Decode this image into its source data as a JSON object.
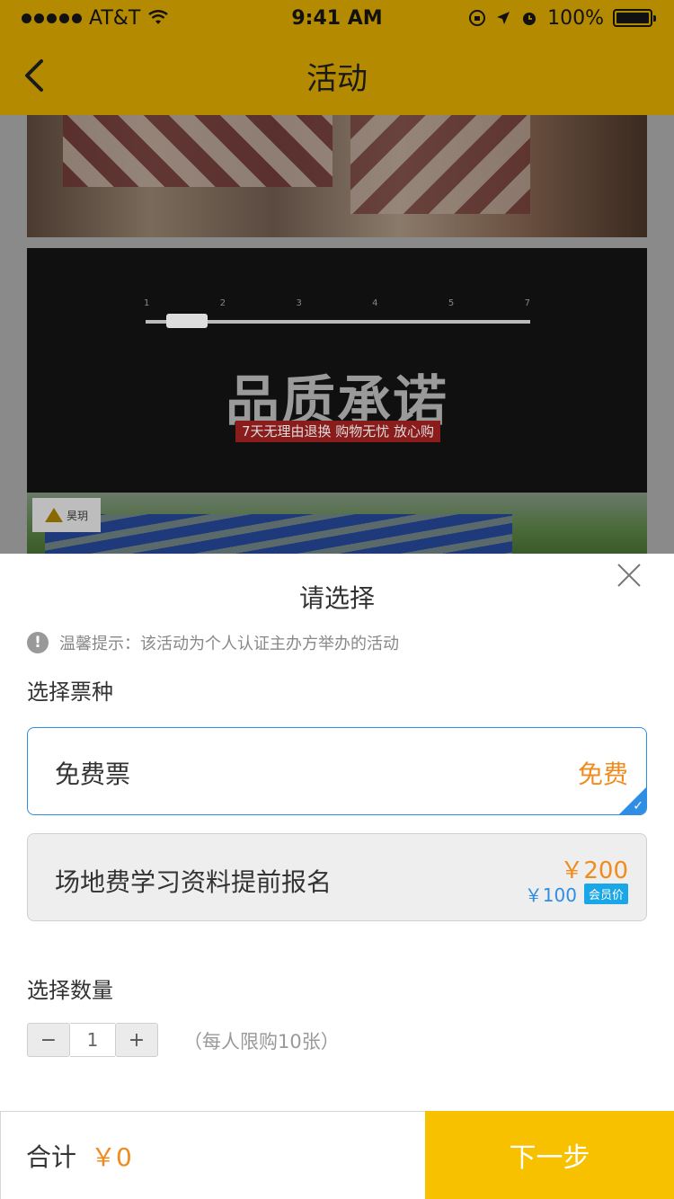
{
  "status_bar": {
    "carrier": "AT&T",
    "time": "9:41 AM",
    "battery": "100%"
  },
  "nav": {
    "title": "活动"
  },
  "banner": {
    "ruler_numbers": [
      "1",
      "2",
      "3",
      "4",
      "5",
      "7"
    ],
    "title": "品质承诺",
    "subtitle": "7天无理由退换 购物无忧 放心购",
    "logo_text": "昊玥"
  },
  "sheet": {
    "title": "请选择",
    "notice": "温馨提示：该活动为个人认证主办方举办的活动",
    "ticket_section_label": "选择票种",
    "tickets": [
      {
        "name": "免费票",
        "price": "免费",
        "selected": true
      },
      {
        "name": "场地费学习资料提前报名",
        "price": "￥200",
        "member_price": "￥100",
        "member_tag": "会员价",
        "selected": false
      }
    ],
    "quantity_section_label": "选择数量",
    "quantity": {
      "minus": "−",
      "value": "1",
      "plus": "+",
      "limit_note": "（每人限购10张）"
    }
  },
  "footer": {
    "total_label": "合计",
    "total_value": "￥0",
    "next_label": "下一步"
  },
  "colors": {
    "brand_yellow": "#f7c100",
    "accent_orange": "#f08c1e",
    "accent_blue": "#2f8de4"
  }
}
